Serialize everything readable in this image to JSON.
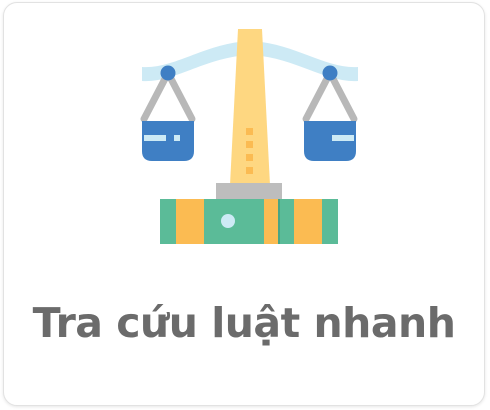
{
  "card": {
    "title": "Tra cứu luật nhanh",
    "icon": "scales-of-justice-icon"
  },
  "colors": {
    "beam": "#cdeaf5",
    "pillar": "#fed781",
    "pivot": "#3f7fc4",
    "pan": "#3f7fc4",
    "cord": "#b8b8b8",
    "base_green": "#5bbb98",
    "base_orange": "#fbbb52",
    "text": "#6b6b6b"
  }
}
